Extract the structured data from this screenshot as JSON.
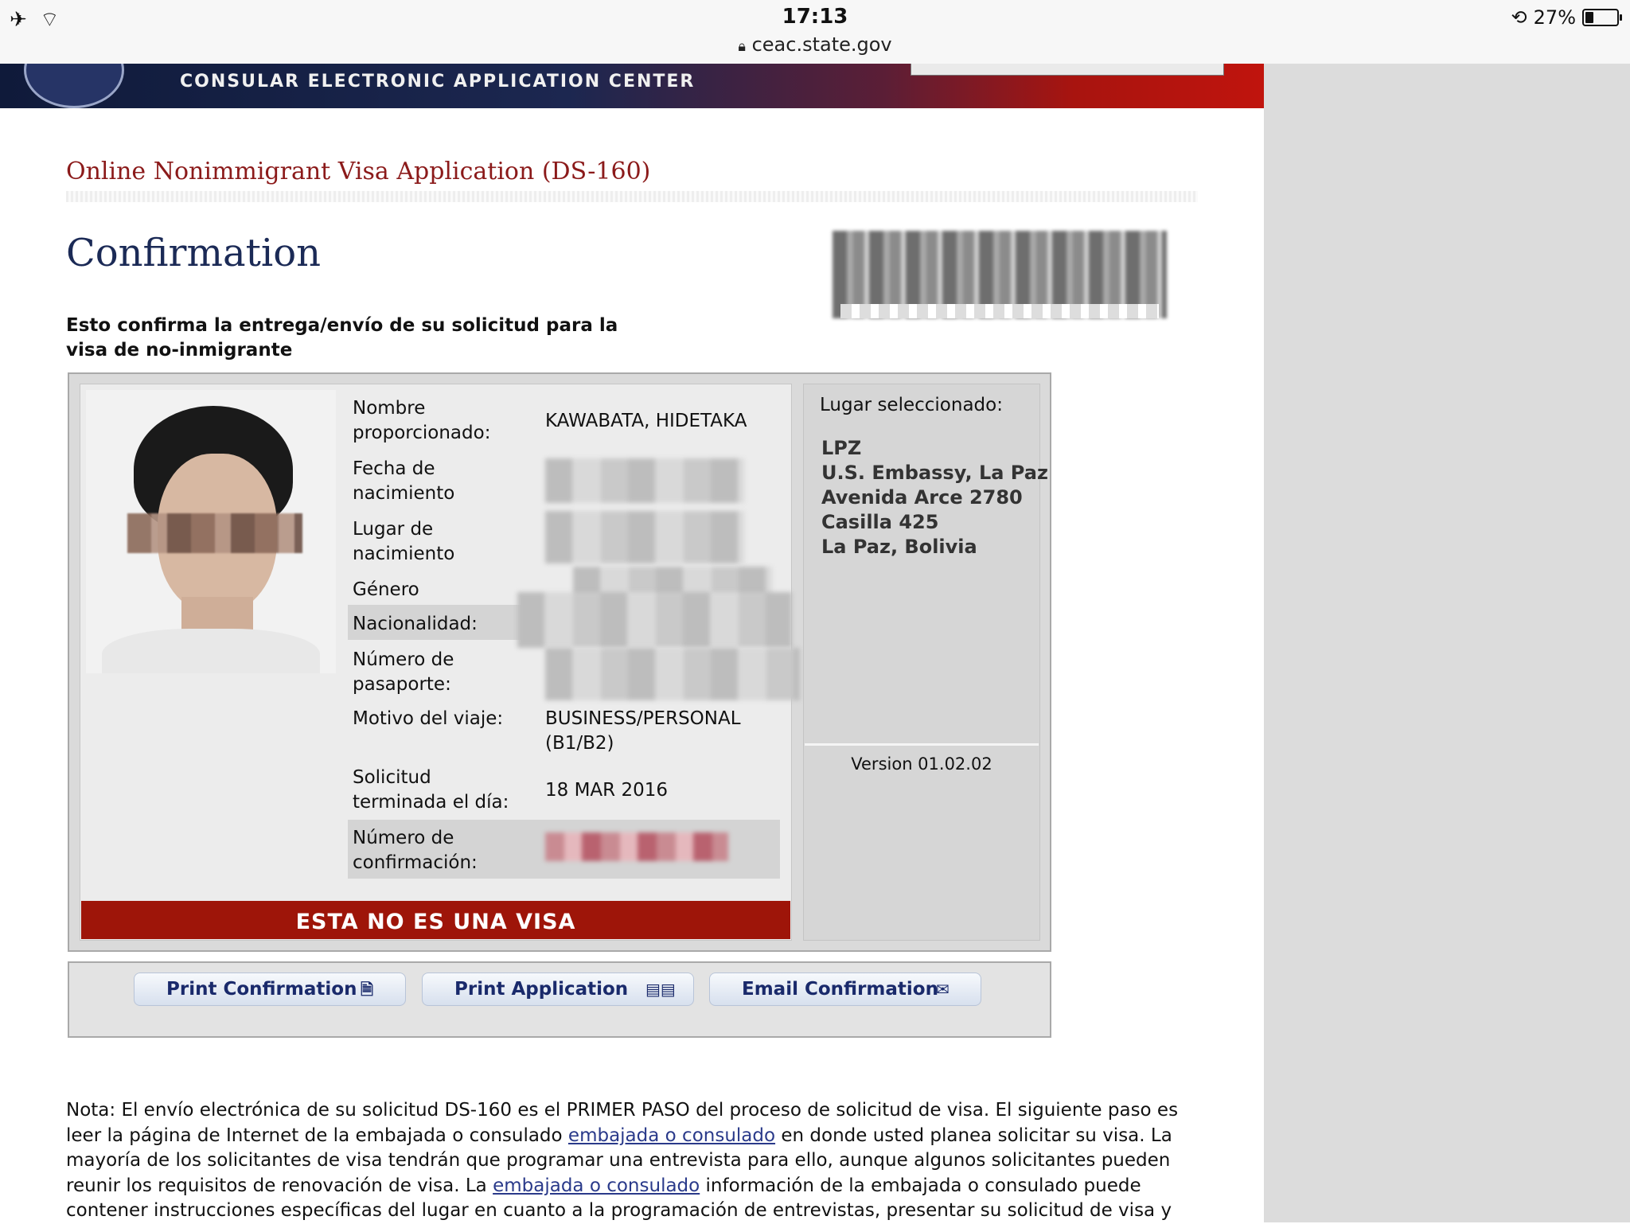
{
  "status_bar": {
    "time": "17:13",
    "url": "ceac.state.gov",
    "battery": "27%",
    "battery_level": 0.27,
    "icons": [
      "airplane-icon",
      "wifi-icon",
      "lock-icon",
      "orientation-lock-icon",
      "battery-icon"
    ]
  },
  "banner": {
    "title": "CONSULAR ELECTRONIC APPLICATION CENTER"
  },
  "page": {
    "app_title": "Online Nonimmigrant Visa Application (DS-160)",
    "title": "Confirmation",
    "subtitle": "Esto confirma la entrega/envío de su solicitud para la visa de no-inmigrante"
  },
  "applicant": {
    "rows": [
      {
        "label": "Nombre proporcionado:",
        "value": "KAWABATA, HIDETAKA"
      },
      {
        "label": "Fecha de nacimiento",
        "value": ""
      },
      {
        "label": "Lugar de nacimiento",
        "value": ""
      },
      {
        "label": "Género",
        "value": ""
      },
      {
        "label": "Nacionalidad:",
        "value": ""
      },
      {
        "label": "Número de pasaporte:",
        "value": ""
      },
      {
        "label": "Motivo del viaje:",
        "value": "BUSINESS/PERSONAL (B1/B2)"
      },
      {
        "label": "Solicitud terminada el día:",
        "value": "18 MAR 2016"
      },
      {
        "label": "Número de confirmación:",
        "value": ""
      }
    ],
    "banner": "ESTA NO ES UNA VISA"
  },
  "location": {
    "label": "Lugar seleccionado:",
    "lines": [
      "LPZ",
      "U.S. Embassy, La Paz",
      "Avenida Arce 2780",
      "Casilla 425",
      "La Paz, Bolivia"
    ],
    "version": "Version 01.02.02"
  },
  "actions": {
    "print_confirmation": "Print Confirmation",
    "print_application": "Print Application",
    "email_confirmation": "Email Confirmation"
  },
  "note": {
    "part1": "Nota: El envío electrónica de su solicitud DS-160 es el PRIMER PASO del proceso de solicitud de visa. El siguiente paso es leer la página de Internet de la embajada o consulado ",
    "link1": "embajada o consulado",
    "part2": " en donde usted planea solicitar su visa. La mayoría de los solicitantes de visa tendrán que programar una entrevista para ello, aunque algunos solicitantes pueden reunir los requisitos de renovación de visa. La ",
    "link2": "embajada o consulado",
    "part3": " información de la embajada o consulado puede contener instrucciones específicas del lugar en cuanto a la programación de entrevistas, presentar su solicitud de visa y"
  }
}
